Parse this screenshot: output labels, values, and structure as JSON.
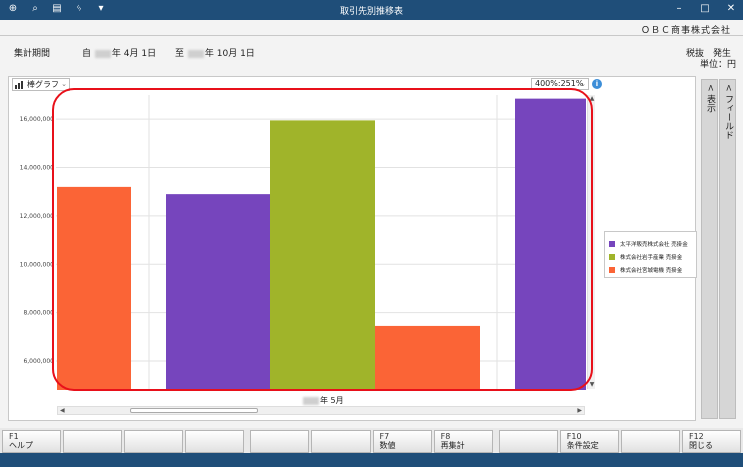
{
  "window": {
    "title": "取引先別推移表"
  },
  "company": "ＯＢＣ商事株式会社",
  "header": {
    "period_label": "集計期間",
    "from_prefix": "自",
    "from_suffix": "年  4月 1日",
    "to_prefix": "至",
    "to_suffix": "年 10月 1日",
    "tax": "税抜",
    "occurrence": "発生",
    "unit": "単位：円"
  },
  "controls": {
    "graph_type": "棒グラフ",
    "zoom": "400%:251%"
  },
  "side_tabs": {
    "display": "表示",
    "field": "フィールド"
  },
  "fkeys": [
    {
      "key": "F1",
      "label": "ヘルプ"
    },
    {
      "key": "",
      "label": ""
    },
    {
      "key": "",
      "label": ""
    },
    {
      "key": "",
      "label": ""
    },
    {
      "key": "",
      "label": ""
    },
    {
      "key": "",
      "label": ""
    },
    {
      "key": "F7",
      "label": "数値"
    },
    {
      "key": "F8",
      "label": "再集計"
    },
    {
      "key": "",
      "label": ""
    },
    {
      "key": "F10",
      "label": "条件設定"
    },
    {
      "key": "",
      "label": ""
    },
    {
      "key": "F12",
      "label": "閉じる"
    }
  ],
  "chart_data": {
    "type": "bar",
    "xlabel": "年  5月",
    "ylim": [
      4800000,
      17000000
    ],
    "y_ticks": [
      "6,000,000",
      "8,000,000",
      "10,000,000",
      "12,000,000",
      "14,000,000",
      "16,000,000"
    ],
    "y_tick_values": [
      6000000,
      8000000,
      10000000,
      12000000,
      14000000,
      16000000
    ],
    "series": [
      {
        "name": "太平洋販売株式会社 売掛金",
        "color": "#7645bd"
      },
      {
        "name": "株式会社岩手産業 売掛金",
        "color": "#a0b42a"
      },
      {
        "name": "株式会社宮城電機 売掛金",
        "color": "#fb6436"
      }
    ],
    "bars": [
      {
        "series": 2,
        "value": 13200000
      },
      {
        "series": 0,
        "value": 12900000
      },
      {
        "series": 1,
        "value": 15950000
      },
      {
        "series": 2,
        "value": 7450000
      },
      {
        "series": 0,
        "value": 16850000
      }
    ]
  }
}
